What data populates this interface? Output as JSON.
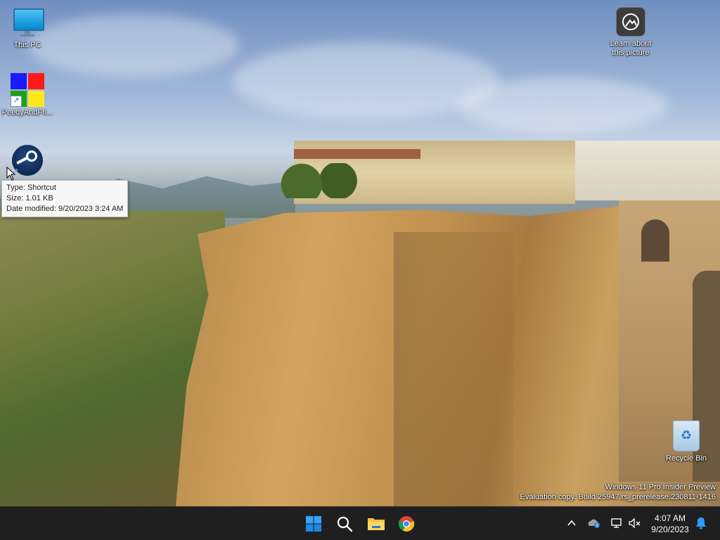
{
  "desktop": {
    "icons": [
      {
        "label": "This PC",
        "icon": "monitor-icon"
      },
      {
        "label": "PeedyAndFri...",
        "icon": "app-shortcut-icon"
      },
      {
        "label": "",
        "icon": "steam-icon"
      },
      {
        "label": "Learn about this picture",
        "icon": "camera-info-icon"
      },
      {
        "label": "Recycle Bin",
        "icon": "recycle-bin-icon"
      }
    ],
    "learn_line1": "Learn about",
    "learn_line2": "this picture",
    "tooltip": {
      "type": "Type: Shortcut",
      "size": "Size: 1.01 KB",
      "modified": "Date modified: 9/20/2023 3:24 AM"
    },
    "watermark": {
      "line1": "Windows 11 Pro Insider Preview",
      "line2": "Evaluation copy. Build 25947.rs_prerelease.230811-1416"
    }
  },
  "taskbar": {
    "pinned": [
      "start-icon",
      "search-icon",
      "file-explorer-icon",
      "chrome-icon"
    ],
    "tray": [
      "chevron-up-icon",
      "onedrive-icon",
      "network-icon",
      "volume-muted-icon",
      "notification-bell-icon"
    ],
    "clock": {
      "time": "4:07 AM",
      "date": "9/20/2023"
    }
  },
  "colors": {
    "taskbar_bg": "#1f1f1f",
    "start_blue": "#1e90ff",
    "explorer_yellow": "#f5c542"
  }
}
